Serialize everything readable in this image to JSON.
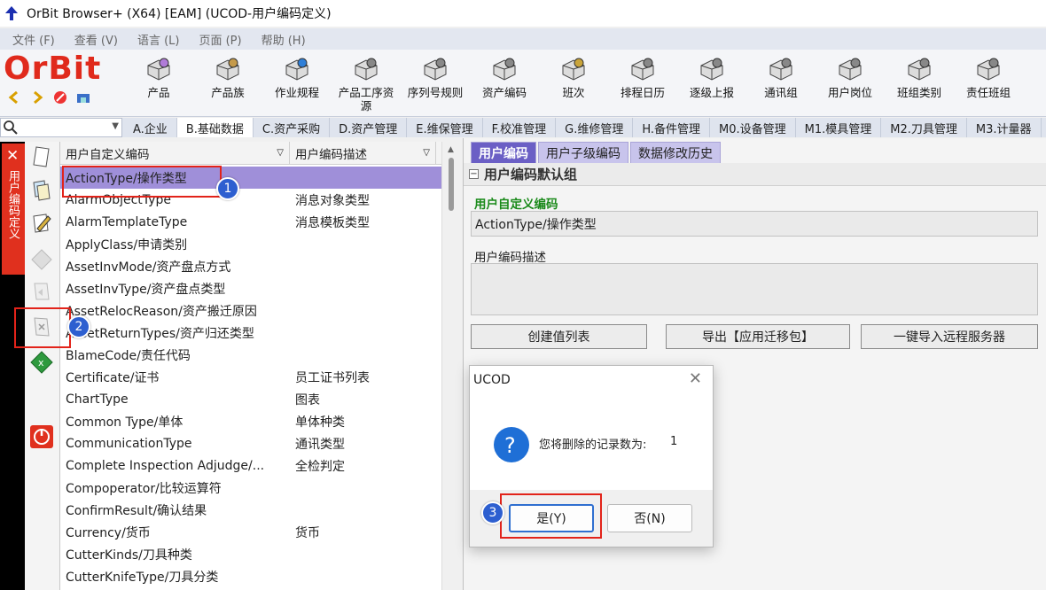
{
  "window": {
    "title": "OrBit Browser+ (X64) [EAM] (UCOD-用户编码定义)"
  },
  "menu": [
    "文件 (F)",
    "查看 (V)",
    "语言 (L)",
    "页面 (P)",
    "帮助 (H)"
  ],
  "logo": {
    "text": "OrBit"
  },
  "toolbar": [
    {
      "label": "产品",
      "icon": "product-icon"
    },
    {
      "label": "产品族",
      "icon": "product-family-icon"
    },
    {
      "label": "作业规程",
      "icon": "procedure-gear-icon"
    },
    {
      "label": "产品工序资源",
      "icon": "process-resource-icon"
    },
    {
      "label": "序列号规则",
      "icon": "serial-rule-icon"
    },
    {
      "label": "资产编码",
      "icon": "asset-code-icon"
    },
    {
      "label": "班次",
      "icon": "shift-clock-icon"
    },
    {
      "label": "排程日历",
      "icon": "calendar-icon"
    },
    {
      "label": "逐级上报",
      "icon": "escalation-icon"
    },
    {
      "label": "通讯组",
      "icon": "comm-group-icon"
    },
    {
      "label": "用户岗位",
      "icon": "user-post-icon"
    },
    {
      "label": "班组类别",
      "icon": "team-category-icon"
    },
    {
      "label": "责任班组",
      "icon": "responsible-team-icon"
    }
  ],
  "module_tabs": [
    {
      "label": "A.企业",
      "active": false
    },
    {
      "label": "B.基础数据",
      "active": true
    },
    {
      "label": "C.资产采购",
      "active": false
    },
    {
      "label": "D.资产管理",
      "active": false
    },
    {
      "label": "E.维保管理",
      "active": false
    },
    {
      "label": "F.校准管理",
      "active": false
    },
    {
      "label": "G.维修管理",
      "active": false
    },
    {
      "label": "H.备件管理",
      "active": false
    },
    {
      "label": "M0.设备管理",
      "active": false
    },
    {
      "label": "M1.模具管理",
      "active": false
    },
    {
      "label": "M2.刀具管理",
      "active": false
    },
    {
      "label": "M3.计量器",
      "active": false
    }
  ],
  "side_tab": {
    "label": "用户编码定义"
  },
  "list": {
    "columns": [
      "用户自定义编码",
      "用户编码描述"
    ],
    "rows": [
      {
        "code": "ActionType/操作类型",
        "desc": "",
        "selected": true
      },
      {
        "code": "AlarmObjectType",
        "desc": "消息对象类型"
      },
      {
        "code": "AlarmTemplateType",
        "desc": "消息模板类型"
      },
      {
        "code": "ApplyClass/申请类别",
        "desc": ""
      },
      {
        "code": "AssetInvMode/资产盘点方式",
        "desc": ""
      },
      {
        "code": "AssetInvType/资产盘点类型",
        "desc": ""
      },
      {
        "code": "AssetRelocReason/资产搬迁原因",
        "desc": ""
      },
      {
        "code": "AssetReturnTypes/资产归还类型",
        "desc": ""
      },
      {
        "code": "BlameCode/责任代码",
        "desc": ""
      },
      {
        "code": "Certificate/证书",
        "desc": "员工证书列表"
      },
      {
        "code": "ChartType",
        "desc": "图表"
      },
      {
        "code": "Common Type/单体",
        "desc": "单体种类"
      },
      {
        "code": "CommunicationType",
        "desc": "通讯类型"
      },
      {
        "code": "Complete Inspection Adjudge/...",
        "desc": "全检判定"
      },
      {
        "code": "Compoperator/比较运算符",
        "desc": ""
      },
      {
        "code": "ConfirmResult/确认结果",
        "desc": ""
      },
      {
        "code": "Currency/货币",
        "desc": "货币"
      },
      {
        "code": "CutterKinds/刀具种类",
        "desc": ""
      },
      {
        "code": "CutterKnifeType/刀具分类",
        "desc": ""
      }
    ]
  },
  "detail": {
    "tabs": [
      {
        "label": "用户编码",
        "active": true
      },
      {
        "label": "用户子级编码",
        "active": false
      },
      {
        "label": "数据修改历史",
        "active": false
      }
    ],
    "group_title": "用户编码默认组",
    "code_label": "用户自定义编码",
    "code_value": "ActionType/操作类型",
    "desc_label": "用户编码描述",
    "desc_value": "",
    "buttons": [
      "创建值列表",
      "导出【应用迁移包】",
      "一键导入远程服务器"
    ]
  },
  "dialog": {
    "title": "UCOD",
    "message": "您将删除的记录数为:",
    "count": "1",
    "yes": "是(Y)",
    "no": "否(N)"
  },
  "annotations": [
    "1",
    "2",
    "3"
  ],
  "colors": {
    "brand_red": "#e02a1c",
    "selected_row": "#9f8fd9",
    "active_tab": "#6b5fc5",
    "annotation_blue": "#2d5fd0",
    "annotation_red": "#e2231a"
  }
}
